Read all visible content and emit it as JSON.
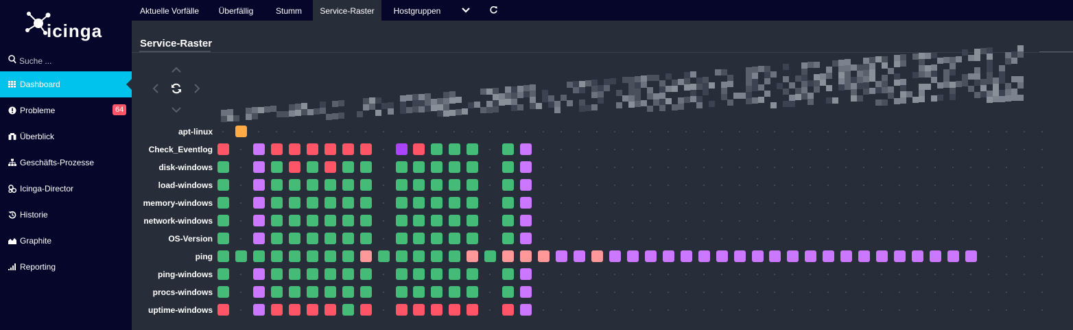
{
  "app": {
    "logo_text": "icinga"
  },
  "sidebar": {
    "search_placeholder": "Suche ...",
    "items": [
      {
        "label": "Dashboard",
        "icon": "dashboard-icon",
        "active": true
      },
      {
        "label": "Probleme",
        "icon": "problems-icon",
        "badge": "64"
      },
      {
        "label": "Überblick",
        "icon": "overview-icon"
      },
      {
        "label": "Geschäfts-Prozesse",
        "icon": "business-process-icon"
      },
      {
        "label": "Icinga-Director",
        "icon": "director-icon"
      },
      {
        "label": "Historie",
        "icon": "history-icon"
      },
      {
        "label": "Graphite",
        "icon": "graphite-icon"
      },
      {
        "label": "Reporting",
        "icon": "reporting-icon"
      }
    ]
  },
  "tabs": [
    {
      "label": "Aktuelle Vorfälle"
    },
    {
      "label": "Überfällig"
    },
    {
      "label": "Stumm"
    },
    {
      "label": "Service-Raster",
      "active": true
    },
    {
      "label": "Hostgruppen"
    }
  ],
  "page": {
    "title": "Service-Raster"
  },
  "colors": {
    "ok": "#44bb77",
    "critical": "#ff5566",
    "warning": "#ffaa44",
    "unknown": "#cc77ff",
    "unknown_dark": "#aa44ff",
    "critical_ack": "#ff9999",
    "accent": "#00c3ed"
  },
  "grid": {
    "rows": [
      {
        "service": "apt-linux",
        "cells": "-W"
      },
      {
        "service": "Check_Eventlog",
        "cells": "C-UCCCCCC-PCOOO-OU"
      },
      {
        "service": "disk-windows",
        "cells": "O-UOCOCOO-OOOOO-OU"
      },
      {
        "service": "load-windows",
        "cells": "O-UOOOOOO-OOOOO-OU"
      },
      {
        "service": "memory-windows",
        "cells": "O-UOOOOOO-OOOOO-OU"
      },
      {
        "service": "network-windows",
        "cells": "O-UOOOOOO-OOOOO-OU"
      },
      {
        "service": "OS-Version",
        "cells": "O-UOOOOOO-OOOOO-OU"
      },
      {
        "service": "ping",
        "cells": "OOOOOOOOAOOOOOAOAAAUUAUUUUUUUUUUUUUUUUUUUUUU"
      },
      {
        "service": "ping-windows",
        "cells": "O-UOOOOOO-OOOOO-OU"
      },
      {
        "service": "procs-windows",
        "cells": "O-UOOOOOO-OOOOO-OU"
      },
      {
        "service": "uptime-windows",
        "cells": "C-UCCCCOC-CCCCC-CU"
      }
    ]
  }
}
